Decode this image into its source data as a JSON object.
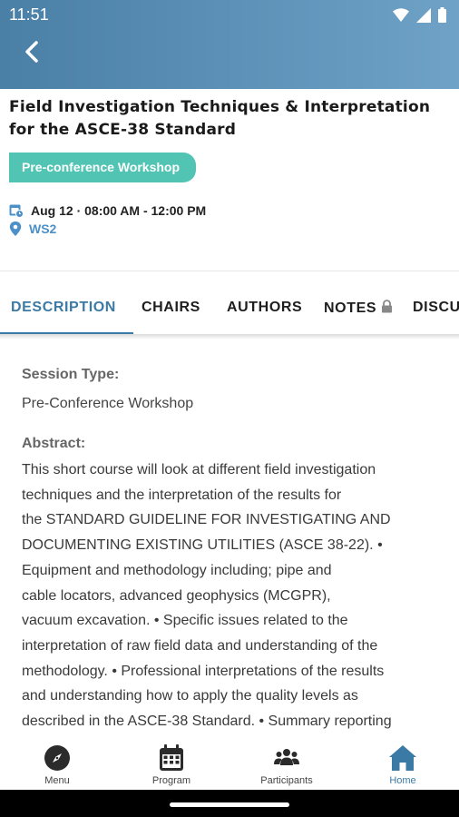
{
  "status_bar": {
    "time": "11:51"
  },
  "session": {
    "title": "Field Investigation Techniques & Interpretation for the ASCE-38 Standard",
    "badge": "Pre-conference Workshop",
    "datetime": "Aug 12 · 08:00 AM - 12:00 PM",
    "location": "WS2"
  },
  "tabs": [
    {
      "label": "DESCRIPTION",
      "active": true
    },
    {
      "label": "CHAIRS",
      "active": false
    },
    {
      "label": "AUTHORS",
      "active": false
    },
    {
      "label": "NOTES",
      "active": false
    },
    {
      "label": "DISCU",
      "active": false
    }
  ],
  "description": {
    "session_type_label": "Session Type:",
    "session_type_value": "Pre-Conference Workshop",
    "abstract_label": "Abstract:",
    "abstract_text": "This short course will look at different field investigation\ntechniques and the interpretation of the results for\nthe STANDARD GUIDELINE FOR INVESTIGATING AND\nDOCUMENTING EXISTING UTILITIES (ASCE 38-22). •\nEquipment and methodology including; pipe and\ncable locators, advanced geophysics (MCGPR),\nvacuum excavation. • Specific issues related to the\ninterpretation of raw field data and understanding of the\nmethodology. • Professional interpretations of the results\nand understanding how to apply the quality levels as\ndescribed in the ASCE-38 Standard. • Summary reporting"
  },
  "bottom_nav": [
    {
      "label": "Menu",
      "icon": "compass-icon",
      "active": false
    },
    {
      "label": "Program",
      "icon": "calendar-icon",
      "active": false
    },
    {
      "label": "Participants",
      "icon": "users-icon",
      "active": false
    },
    {
      "label": "Home",
      "icon": "home-icon",
      "active": true
    }
  ],
  "colors": {
    "header_start": "#4a7fa6",
    "header_end": "#6fa2c6",
    "badge": "#52c4b3",
    "accent": "#3c7aa6",
    "location": "#4b90c8"
  }
}
